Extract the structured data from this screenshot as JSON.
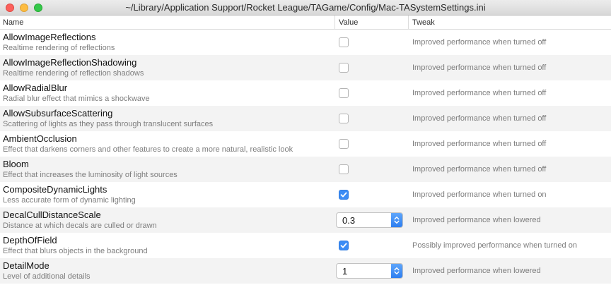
{
  "window": {
    "title": "~/Library/Application Support/Rocket League/TAGame/Config/Mac-TASystemSettings.ini"
  },
  "columns": {
    "name": "Name",
    "value": "Value",
    "tweak": "Tweak"
  },
  "colors": {
    "accent": "#3b8cf5",
    "row_alt": "#f3f3f3",
    "description_text": "#7d7d7d"
  },
  "rows": [
    {
      "name": "AllowImageReflections",
      "desc": "Realtime rendering of reflections",
      "type": "checkbox",
      "checked": false,
      "tweak": "Improved performance when turned off"
    },
    {
      "name": "AllowImageReflectionShadowing",
      "desc": "Realtime rendering of reflection shadows",
      "type": "checkbox",
      "checked": false,
      "tweak": "Improved performance when turned off"
    },
    {
      "name": "AllowRadialBlur",
      "desc": "Radial blur effect that mimics a shockwave",
      "type": "checkbox",
      "checked": false,
      "tweak": "Improved performance when turned off"
    },
    {
      "name": "AllowSubsurfaceScattering",
      "desc": "Scattering of lights as they pass through translucent surfaces",
      "type": "checkbox",
      "checked": false,
      "tweak": "Improved performance when turned off"
    },
    {
      "name": "AmbientOcclusion",
      "desc": "Effect that darkens corners and other features to create a more natural, realistic look",
      "type": "checkbox",
      "checked": false,
      "tweak": "Improved performance when turned off"
    },
    {
      "name": "Bloom",
      "desc": "Effect that increases the luminosity of light sources",
      "type": "checkbox",
      "checked": false,
      "tweak": "Improved performance when turned off"
    },
    {
      "name": "CompositeDynamicLights",
      "desc": "Less accurate form of dynamic lighting",
      "type": "checkbox",
      "checked": true,
      "tweak": "Improved performance when turned on"
    },
    {
      "name": "DecalCullDistanceScale",
      "desc": "Distance at which decals are culled or drawn",
      "type": "select",
      "value": "0.3",
      "tweak": "Improved performance when lowered"
    },
    {
      "name": "DepthOfField",
      "desc": "Effect that blurs objects in the background",
      "type": "checkbox",
      "checked": true,
      "tweak": "Possibly improved performance when turned on"
    },
    {
      "name": "DetailMode",
      "desc": "Level of additional details",
      "type": "select",
      "value": "1",
      "tweak": "Improved performance when lowered"
    }
  ]
}
